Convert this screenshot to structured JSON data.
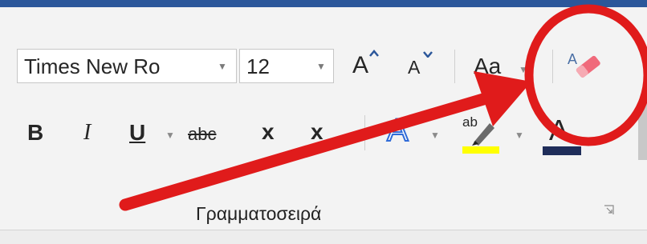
{
  "colors": {
    "title_bar": "#2b579a",
    "ribbon": "#f3f3f3",
    "annotation": "#e01b1b",
    "highlight": "#ffff00",
    "font_color": "#1f2d5a",
    "text_effects": "#2f6bd8"
  },
  "font_group": {
    "font_name": "Times New Ro",
    "font_size": "12",
    "grow_font": "A",
    "shrink_font": "A",
    "change_case": "Aa",
    "bold": "B",
    "italic": "I",
    "underline": "U",
    "strikethrough": "abc",
    "subscript": "x",
    "superscript": "x",
    "text_effects": "A",
    "highlight": "ab",
    "font_color": "A",
    "group_label": "Γραμματοσειρά"
  },
  "icons": {
    "clear_formatting": "eraser-icon",
    "dialog_launcher": "dialog-launcher-icon",
    "dropdown": "chevron-down-icon"
  },
  "annotation": {
    "shape": "red-circle",
    "arrow": "red-arrow",
    "target": "clear-formatting-button"
  }
}
